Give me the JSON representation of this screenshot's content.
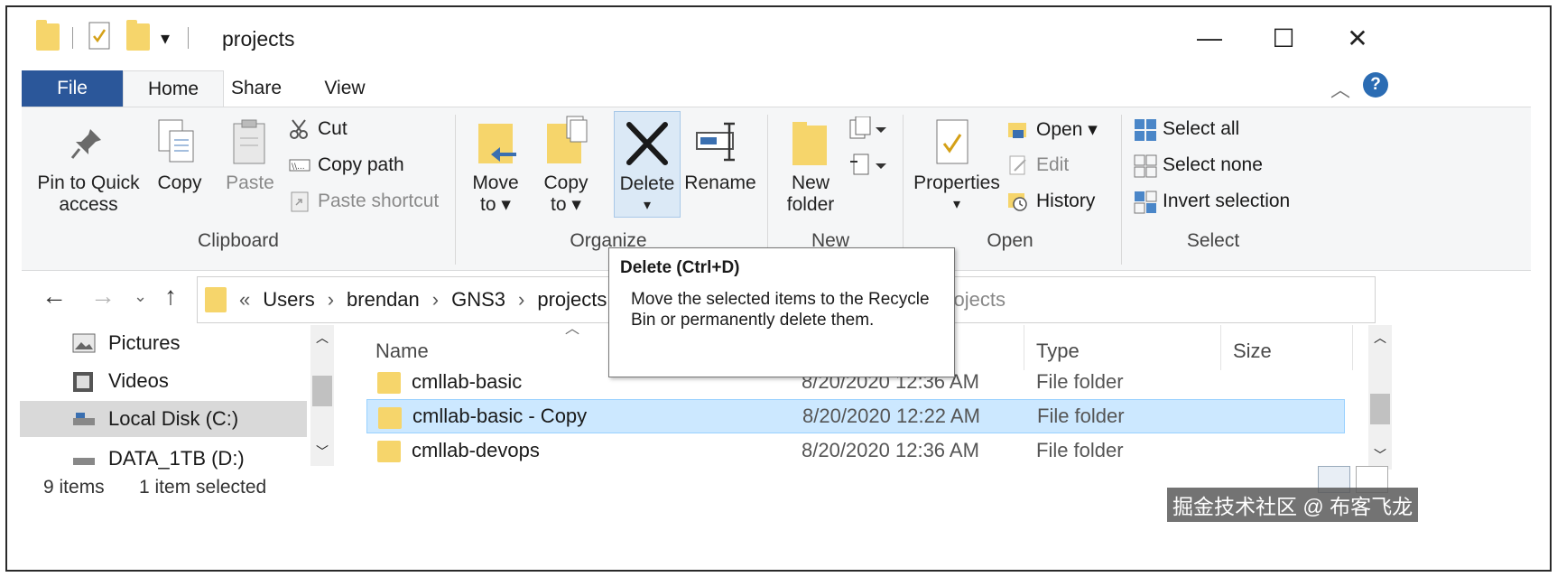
{
  "window": {
    "title": "projects",
    "minimize": "—",
    "maximize": "☐",
    "close": "✕"
  },
  "tabs": [
    {
      "label": "File"
    },
    {
      "label": "Home"
    },
    {
      "label": "Share"
    },
    {
      "label": "View"
    }
  ],
  "ribbon": {
    "clipboard": {
      "label": "Clipboard",
      "pin_line1": "Pin to Quick",
      "pin_line2": "access",
      "copy": "Copy",
      "paste": "Paste",
      "cut": "Cut",
      "copy_path": "Copy path",
      "paste_shortcut": "Paste shortcut"
    },
    "organize": {
      "label": "Organize",
      "move_line1": "Move",
      "move_line2": "to ▾",
      "copy_line1": "Copy",
      "copy_line2": "to ▾",
      "delete": "Delete",
      "delete_arrow": "▾",
      "rename": "Rename"
    },
    "new": {
      "label": "New",
      "new_folder_line1": "New",
      "new_folder_line2": "folder"
    },
    "open": {
      "label": "Open",
      "properties": "Properties",
      "properties_arrow": "▾",
      "open": "Open ▾",
      "edit": "Edit",
      "history": "History"
    },
    "select": {
      "label": "Select",
      "select_all": "Select all",
      "select_none": "Select none",
      "invert": "Invert selection"
    }
  },
  "address": {
    "prefix": "«",
    "crumbs": [
      "Users",
      "brendan",
      "GNS3",
      "projects"
    ],
    "search_placeholder": "projects"
  },
  "navpane": {
    "items": [
      {
        "label": "Pictures",
        "icon": "pictures-icon",
        "selected": false
      },
      {
        "label": "Videos",
        "icon": "videos-icon",
        "selected": false
      },
      {
        "label": "Local Disk (C:)",
        "icon": "drive-icon",
        "selected": true
      },
      {
        "label": "DATA_1TB (D:)",
        "icon": "drive-icon",
        "selected": false
      }
    ]
  },
  "filelist": {
    "columns": {
      "name": "Name",
      "type": "Type",
      "size": "Size"
    },
    "rows": [
      {
        "name": "cmllab-basic",
        "date": "8/20/2020 12:36 AM",
        "type": "File folder",
        "selected": false
      },
      {
        "name": "cmllab-basic - Copy",
        "date": "8/20/2020 12:22 AM",
        "type": "File folder",
        "selected": true
      },
      {
        "name": "cmllab-devops",
        "date": "8/20/2020 12:36 AM",
        "type": "File folder",
        "selected": false
      }
    ]
  },
  "status": {
    "count": "9 items",
    "selected": "1 item selected"
  },
  "tooltip": {
    "title": "Delete (Ctrl+D)",
    "body": "Move the selected items to the Recycle Bin or permanently delete them."
  },
  "watermark": "掘金技术社区 @ 布客飞龙",
  "colors": {
    "file_tab": "#2b579a",
    "selection": "#cce8ff",
    "folder": "#f6d56b"
  }
}
